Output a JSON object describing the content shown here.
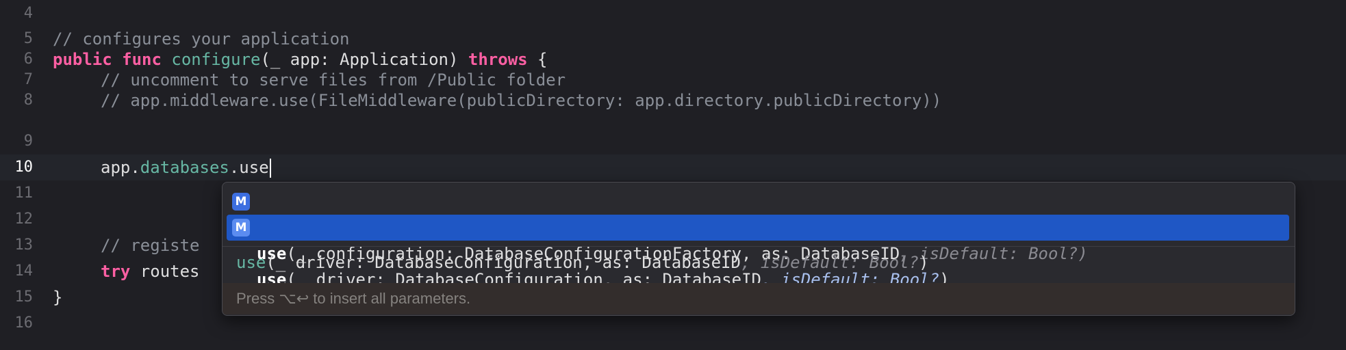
{
  "editor": {
    "lines": [
      {
        "num": "4"
      },
      {
        "num": "5",
        "comment": "// configures your application"
      },
      {
        "num": "6",
        "kw1": "public",
        "kw2": "func",
        "fn": "configure",
        "open": "(_ app: ",
        "type": "Application",
        "close": ") ",
        "kw3": "throws",
        "brace": " {"
      },
      {
        "num": "7",
        "comment": "// uncomment to serve files from /Public folder"
      },
      {
        "num": "8",
        "comment": "// app.middleware.use(FileMiddleware(publicDirectory: app.directory.publicDirectory))"
      },
      {
        "num": "9"
      },
      {
        "num": "10",
        "obj": "app.",
        "prop": "databases",
        "rest": ".use"
      },
      {
        "num": "11"
      },
      {
        "num": "12"
      },
      {
        "num": "13",
        "comment": "// registe"
      },
      {
        "num": "14",
        "kw": "try",
        "rest": " routes"
      },
      {
        "num": "15",
        "text": "}"
      },
      {
        "num": "16"
      }
    ]
  },
  "completion": {
    "suggestions": [
      {
        "badge": "M",
        "name": "use",
        "open": "(_ ",
        "arg1": "configuration",
        "colon1": ": ",
        "type1": "DatabaseConfigurationFactory",
        "sep1": ", ",
        "arg2": "as",
        "colon2": ": ",
        "type2": "DatabaseID",
        "opt": ", isDefault: Bool?",
        "close": ")"
      },
      {
        "badge": "M",
        "name": "use",
        "open": "(_ ",
        "arg1": "driver",
        "colon1": ": ",
        "type1": "DatabaseConfiguration",
        "sep1": ", ",
        "arg2": "as",
        "colon2": ": ",
        "type2": "DatabaseID",
        "opt": ", isDefault: Bool?",
        "close": ")"
      }
    ],
    "detail": {
      "name": "use",
      "sig": "(_ driver: DatabaseConfiguration, as: DatabaseID",
      "opt": ", isDefault: Bool?",
      "close": ")"
    },
    "hint": "Press ⌥↩ to insert all parameters."
  },
  "colors": {
    "background": "#1f1f24",
    "keyword": "#fc5fa3",
    "comment": "#8a8f98",
    "function": "#67b7a4",
    "selection": "#1f57c5"
  }
}
